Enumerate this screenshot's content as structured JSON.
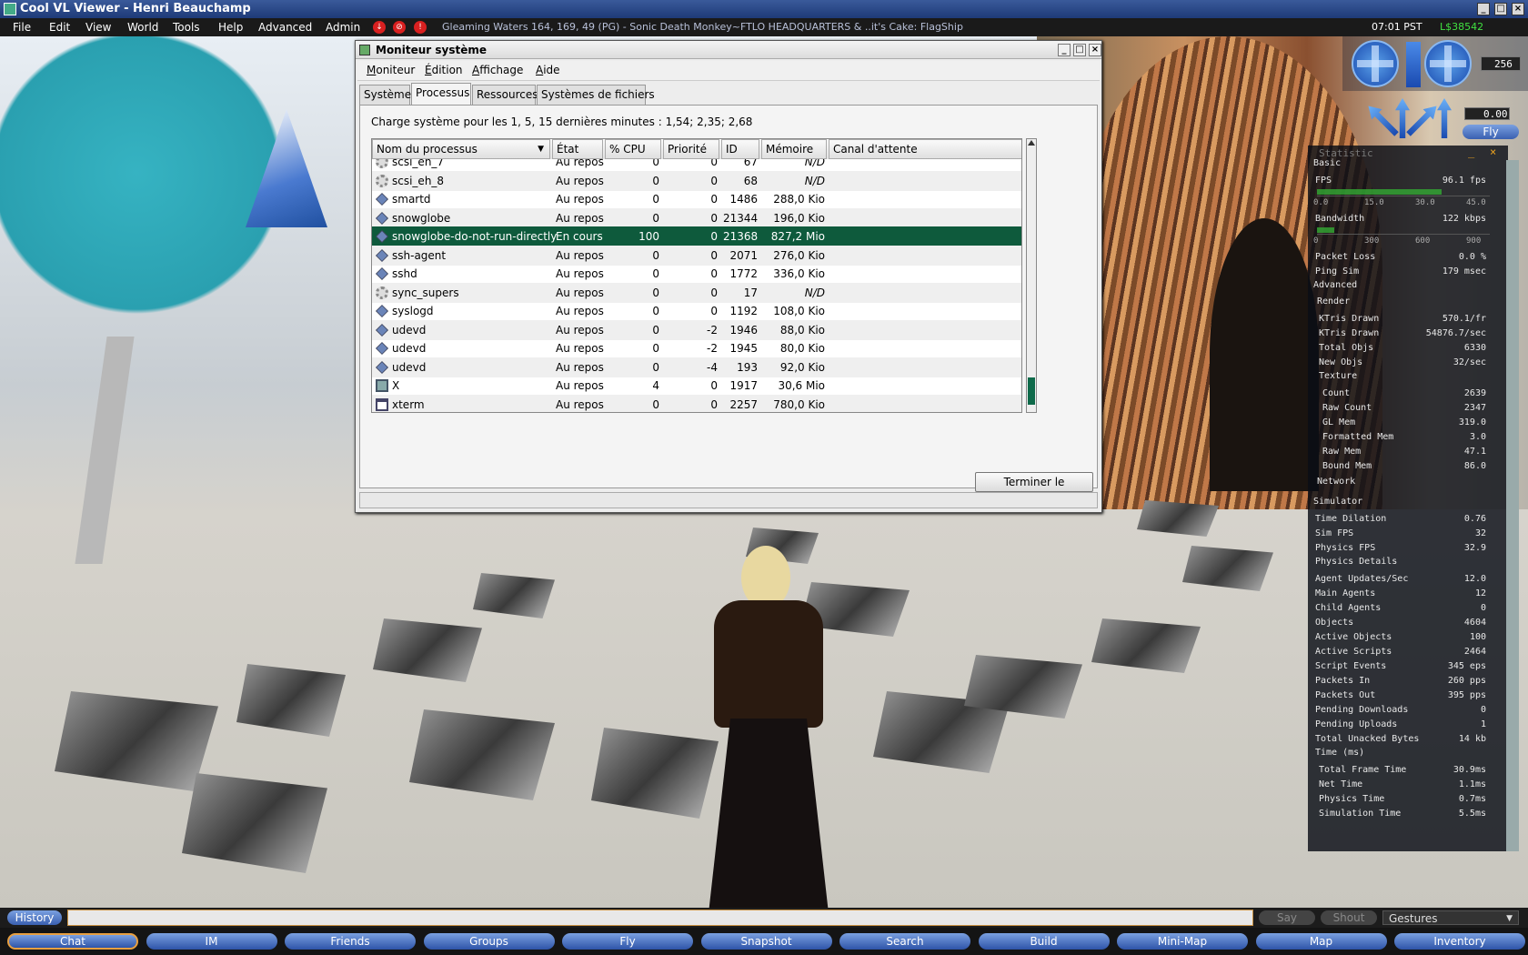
{
  "window": {
    "title": "Cool VL Viewer - Henri Beauchamp"
  },
  "menubar": {
    "items": [
      "File",
      "Edit",
      "View",
      "World",
      "Tools",
      "Help",
      "Advanced",
      "Admin"
    ],
    "location": "Gleaming Waters 164, 169, 49 (PG) - Sonic Death Monkey~FTLO HEADQUARTERS & ..it's Cake: FlagShip",
    "time": "07:01 PST",
    "balance": "L$38542"
  },
  "dialog": {
    "title": "Moniteur système",
    "menu": [
      "Moniteur",
      "Édition",
      "Affichage",
      "Aide"
    ],
    "tabs": [
      "Système",
      "Processus",
      "Ressources",
      "Systèmes de fichiers"
    ],
    "active_tab": "Processus",
    "load_text": "Charge système pour les 1, 5, 15 dernières minutes : 1,54; 2,35; 2,68",
    "columns": [
      "Nom du processus",
      "État",
      "% CPU",
      "Priorité",
      "ID",
      "Mémoire",
      "Canal d'attente"
    ],
    "rows": [
      {
        "icon": "gear-icon",
        "name": "scsi_eh_7",
        "state": "Au repos",
        "cpu": "0",
        "prio": "0",
        "id": "67",
        "mem": "N/D"
      },
      {
        "icon": "gear-icon",
        "name": "scsi_eh_8",
        "state": "Au repos",
        "cpu": "0",
        "prio": "0",
        "id": "68",
        "mem": "N/D"
      },
      {
        "icon": "diamond-icon",
        "name": "smartd",
        "state": "Au repos",
        "cpu": "0",
        "prio": "0",
        "id": "1486",
        "mem": "288,0 Kio"
      },
      {
        "icon": "diamond-icon",
        "name": "snowglobe",
        "state": "Au repos",
        "cpu": "0",
        "prio": "0",
        "id": "21344",
        "mem": "196,0 Kio"
      },
      {
        "icon": "diamond-icon",
        "name": "snowglobe-do-not-run-directly",
        "state": "En cours",
        "cpu": "100",
        "prio": "0",
        "id": "21368",
        "mem": "827,2 Mio",
        "selected": true
      },
      {
        "icon": "diamond-icon",
        "name": "ssh-agent",
        "state": "Au repos",
        "cpu": "0",
        "prio": "0",
        "id": "2071",
        "mem": "276,0 Kio"
      },
      {
        "icon": "diamond-icon",
        "name": "sshd",
        "state": "Au repos",
        "cpu": "0",
        "prio": "0",
        "id": "1772",
        "mem": "336,0 Kio"
      },
      {
        "icon": "gear-icon",
        "name": "sync_supers",
        "state": "Au repos",
        "cpu": "0",
        "prio": "0",
        "id": "17",
        "mem": "N/D"
      },
      {
        "icon": "diamond-icon",
        "name": "syslogd",
        "state": "Au repos",
        "cpu": "0",
        "prio": "0",
        "id": "1192",
        "mem": "108,0 Kio"
      },
      {
        "icon": "diamond-icon",
        "name": "udevd",
        "state": "Au repos",
        "cpu": "0",
        "prio": "-2",
        "id": "1946",
        "mem": "88,0 Kio"
      },
      {
        "icon": "diamond-icon",
        "name": "udevd",
        "state": "Au repos",
        "cpu": "0",
        "prio": "-2",
        "id": "1945",
        "mem": "80,0 Kio"
      },
      {
        "icon": "diamond-icon",
        "name": "udevd",
        "state": "Au repos",
        "cpu": "0",
        "prio": "-4",
        "id": "193",
        "mem": "92,0 Kio"
      },
      {
        "icon": "monitor-icon",
        "name": "X",
        "state": "Au repos",
        "cpu": "4",
        "prio": "0",
        "id": "1917",
        "mem": "30,6 Mio"
      },
      {
        "icon": "terminal-icon",
        "name": "xterm",
        "state": "Au repos",
        "cpu": "0",
        "prio": "0",
        "id": "2257",
        "mem": "780,0 Kio"
      }
    ],
    "end_button": "Terminer le processus"
  },
  "nav": {
    "zoom": "256",
    "cam": "0.00",
    "fly": "Fly"
  },
  "stats": {
    "header": "Statistic",
    "basic": "Basic",
    "fps_label": "FPS",
    "fps_value": "96.1 fps",
    "fps_ticks": [
      "0.0",
      "15.0",
      "30.0",
      "45.0"
    ],
    "fps_level": 0.72,
    "bw_label": "Bandwidth",
    "bw_value": "122 kbps",
    "bw_ticks": [
      "0",
      "300",
      "600",
      "900"
    ],
    "bw_level": 0.1,
    "rows_basic": [
      [
        "Packet Loss",
        "0.0 %"
      ],
      [
        "Ping Sim",
        "179 msec"
      ]
    ],
    "advanced": "Advanced",
    "render": "Render",
    "rows_render": [
      [
        "KTris Drawn",
        "570.1/fr"
      ],
      [
        "KTris Drawn",
        "54876.7/sec"
      ],
      [
        "Total Objs",
        "6330"
      ],
      [
        "New Objs",
        "32/sec"
      ]
    ],
    "texture": "Texture",
    "rows_texture": [
      [
        "Count",
        "2639"
      ],
      [
        "Raw Count",
        "2347"
      ],
      [
        "GL Mem",
        "319.0"
      ],
      [
        "Formatted Mem",
        "3.0"
      ],
      [
        "Raw Mem",
        "47.1"
      ],
      [
        "Bound Mem",
        "86.0"
      ]
    ],
    "network": "Network",
    "simulator": "Simulator",
    "rows_sim": [
      [
        "Time Dilation",
        "0.76"
      ],
      [
        "Sim FPS",
        "32"
      ],
      [
        "Physics FPS",
        "32.9"
      ]
    ],
    "physics": "Physics Details",
    "rows_sim2": [
      [
        "Agent Updates/Sec",
        "12.0"
      ],
      [
        "Main Agents",
        "12"
      ],
      [
        "Child Agents",
        "0"
      ],
      [
        "Objects",
        "4604"
      ],
      [
        "Active Objects",
        "100"
      ],
      [
        "Active Scripts",
        "2464"
      ],
      [
        "Script Events",
        "345 eps"
      ],
      [
        "Packets In",
        "260 pps"
      ],
      [
        "Packets Out",
        "395 pps"
      ],
      [
        "Pending Downloads",
        "0"
      ],
      [
        "Pending Uploads",
        "1"
      ],
      [
        "Total Unacked Bytes",
        "14 kb"
      ]
    ],
    "time": "Time (ms)",
    "rows_time": [
      [
        "Total Frame Time",
        "30.9ms"
      ],
      [
        "Net Time",
        "1.1ms"
      ],
      [
        "Physics Time",
        "0.7ms"
      ],
      [
        "Simulation Time",
        "5.5ms"
      ]
    ]
  },
  "chat": {
    "history": "History",
    "say": "Say",
    "shout": "Shout",
    "gestures": "Gestures"
  },
  "toolbar": [
    "Chat",
    "IM",
    "Friends",
    "Groups",
    "Fly",
    "Snapshot",
    "Search",
    "Build",
    "Mini-Map",
    "Map",
    "Inventory"
  ]
}
